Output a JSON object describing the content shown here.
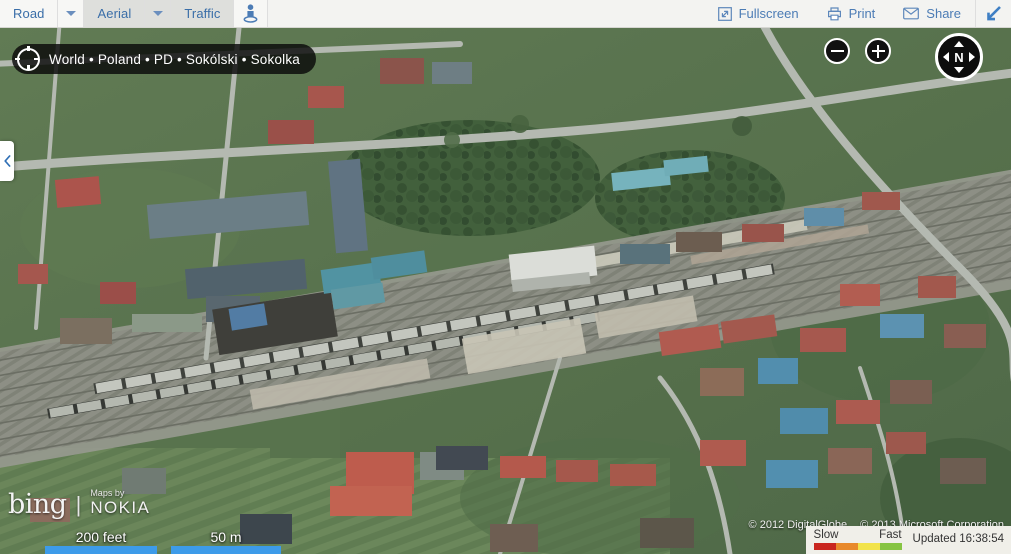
{
  "toolbar": {
    "left": [
      {
        "name": "road",
        "label": "Road",
        "selected": false,
        "has_caret": true
      },
      {
        "name": "aerial",
        "label": "Aerial",
        "selected": true,
        "has_caret": true
      },
      {
        "name": "traffic",
        "label": "Traffic",
        "selected": false,
        "has_caret": false
      }
    ],
    "streetside_icon": "pegman-icon",
    "right": [
      {
        "name": "fullscreen",
        "label": "Fullscreen",
        "icon": "fullscreen-icon"
      },
      {
        "name": "print",
        "label": "Print",
        "icon": "printer-icon"
      },
      {
        "name": "share",
        "label": "Share",
        "icon": "envelope-icon"
      }
    ],
    "collapse_icon": "arrow-down-left-icon"
  },
  "breadcrumb": {
    "icon": "locator-crosshair-icon",
    "text": "World • Poland • PD • Sokólski • Sokolka"
  },
  "controls": {
    "zoom_out_label": "−",
    "zoom_in_label": "+",
    "compass_label": "N",
    "panel_toggle_icon": "chevron-left-icon"
  },
  "branding": {
    "bing": "bing",
    "separator": "|",
    "maps_by": "Maps by",
    "nokia": "NOKIA"
  },
  "scale": {
    "imperial": "200 feet",
    "metric": "50 m"
  },
  "copyright": {
    "imagery": "© 2012 DigitalGlobe",
    "provider": "© 2013 Microsoft Corporation"
  },
  "traffic_legend": {
    "slow_label": "Slow",
    "fast_label": "Fast",
    "colors": [
      "#c9261f",
      "#e8892b",
      "#f2e34a",
      "#86c442"
    ],
    "updated": "Updated 16:38:54"
  },
  "map": {
    "view_type": "aerial-satellite",
    "place": "Sokolka, Sokólski, Poland",
    "features": "railway yard with freight trains, residential streets, agricultural strip fields"
  }
}
